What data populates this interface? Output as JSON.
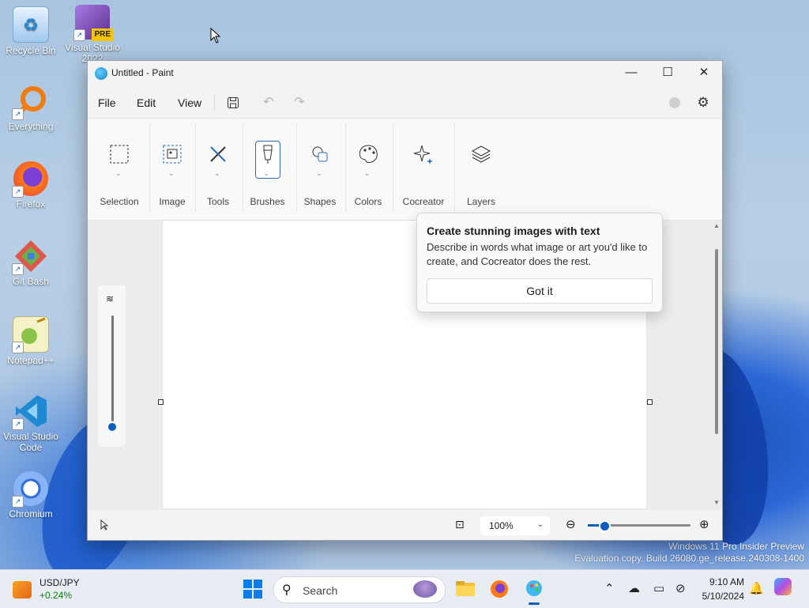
{
  "desktop": {
    "icons": [
      {
        "label": "Recycle Bin"
      },
      {
        "label": "Visual Studio 2022",
        "badge": "PRE"
      },
      {
        "label": "Everything"
      },
      {
        "label": "Firefox"
      },
      {
        "label": "Git Bash"
      },
      {
        "label": "Notepad++"
      },
      {
        "label": "Visual Studio Code"
      },
      {
        "label": "Chromium"
      }
    ],
    "watermark": {
      "line1": "Windows 11 Pro Insider Preview",
      "line2": "Evaluation copy. Build 26080.ge_release.240308-1400"
    }
  },
  "window": {
    "title": "Untitled - Paint",
    "controls": {
      "minimize": "—",
      "maximize": "☐",
      "close": "✕"
    },
    "menu": {
      "file": "File",
      "edit": "Edit",
      "view": "View"
    },
    "toolbar_icons": [
      "save-icon",
      "undo-icon",
      "redo-icon",
      "account-icon",
      "settings-icon"
    ],
    "ribbon": [
      {
        "label": "Selection",
        "icon": "selection-icon"
      },
      {
        "label": "Image",
        "icon": "image-icon"
      },
      {
        "label": "Tools",
        "icon": "tools-icon"
      },
      {
        "label": "Brushes",
        "icon": "brushes-icon",
        "selected": true
      },
      {
        "label": "Shapes",
        "icon": "shapes-icon"
      },
      {
        "label": "Colors",
        "icon": "colors-icon"
      },
      {
        "label": "Cocreator",
        "icon": "cocreator-icon"
      },
      {
        "label": "Layers",
        "icon": "layers-icon"
      }
    ],
    "teaching_tip": {
      "title": "Create stunning images with text",
      "body": "Describe in words what image or art you'd like to create, and Cocreator does the rest.",
      "button": "Got it"
    },
    "status": {
      "zoom": "100%",
      "zoom_slider_fraction": 0.15
    }
  },
  "taskbar": {
    "widget": {
      "line1": "USD/JPY",
      "line2": "+0.24%"
    },
    "search_placeholder": "Search",
    "clock": {
      "time": "9:10 AM",
      "date": "5/10/2024"
    },
    "accent": "#0b5fbf"
  }
}
